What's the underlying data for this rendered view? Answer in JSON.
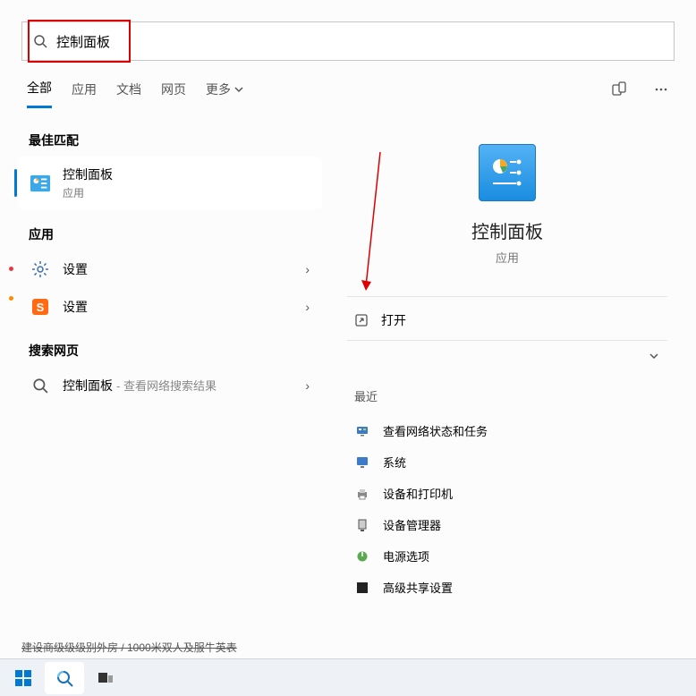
{
  "search": {
    "value": "控制面板"
  },
  "tabs": {
    "all": "全部",
    "apps": "应用",
    "docs": "文档",
    "web": "网页",
    "more": "更多"
  },
  "left": {
    "bestMatch": "最佳匹配",
    "selected": {
      "title": "控制面板",
      "sub": "应用"
    },
    "appsLabel": "应用",
    "apps": [
      "设置",
      "设置"
    ],
    "webLabel": "搜索网页",
    "webItem": {
      "term": "控制面板",
      "suffix": "- 查看网络搜索结果"
    }
  },
  "detail": {
    "title": "控制面板",
    "sub": "应用",
    "open": "打开",
    "recentLabel": "最近",
    "recent": [
      "查看网络状态和任务",
      "系统",
      "设备和打印机",
      "设备管理器",
      "电源选项",
      "高级共享设置"
    ]
  },
  "truncated": "建设商级级级别外房 / 1000米双人及服牛英表"
}
